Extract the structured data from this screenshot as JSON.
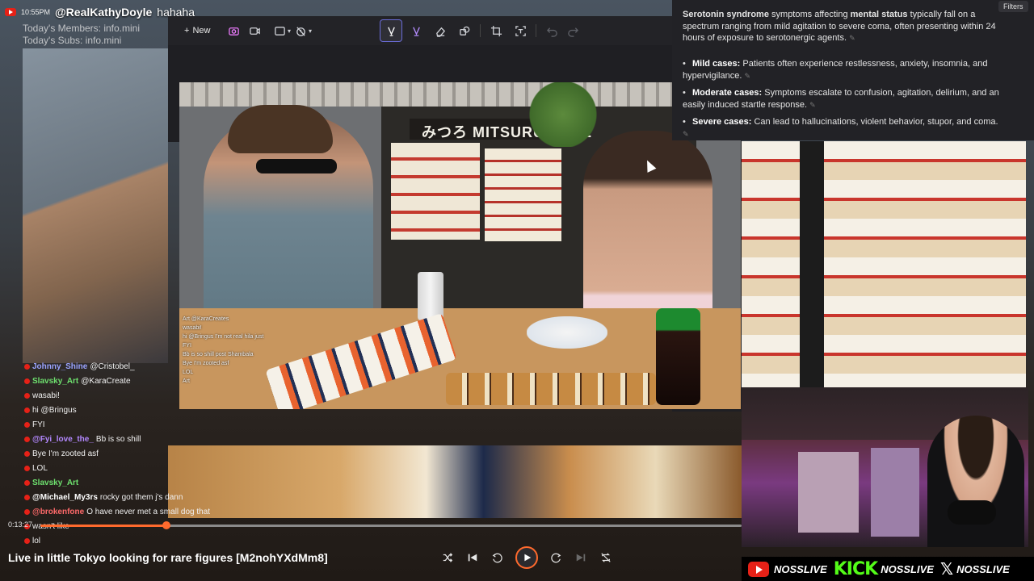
{
  "stream": {
    "time": "10:55PM",
    "handle": "@RealKathyDoyle",
    "caption": "hahaha",
    "overlay_lines": [
      "Today's Members: info.mini",
      "Today's Subs: info.mini"
    ]
  },
  "snip_toolbar": {
    "new_label": "New",
    "icons": [
      "camera-icon",
      "video-icon",
      "rect-mode-icon",
      "delay-icon",
      "highlighter-pen-icon",
      "pen-icon",
      "eraser-icon",
      "shapes-icon",
      "crop-icon",
      "text-extract-icon",
      "undo-icon",
      "redo-icon"
    ]
  },
  "snip_image": {
    "sign_text": "みつろ MITSURU CAFE",
    "chat_lines": [
      "Art @KaraCreates",
      "wasabi!",
      "hi @Bringus I'm not real hila just",
      "FYI",
      "Bb is so shill post Shambala",
      "Bye I'm zooted asf",
      "LOL",
      "Art"
    ]
  },
  "chat": [
    {
      "user": "Johnny_Shine",
      "msg": "@Cristobel_",
      "color": "#9aa3ff"
    },
    {
      "user": "Slavsky_Art",
      "msg": "@KaraCreate",
      "color": "#6ee06e"
    },
    {
      "user": "",
      "msg": "wasabi!",
      "color": "#ff6a6a"
    },
    {
      "user": "",
      "msg": "hi @Bringus",
      "color": "#ffb86c"
    },
    {
      "user": "",
      "msg": "FYI",
      "color": "#ff6a6a"
    },
    {
      "user": "@Fyi_love_the_",
      "msg": "Bb is so shill",
      "color": "#b388ff"
    },
    {
      "user": "",
      "msg": "Bye I'm zooted asf",
      "color": "#ff6a6a"
    },
    {
      "user": "",
      "msg": "LOL",
      "color": "#ff6a6a"
    },
    {
      "user": "Slavsky_Art",
      "msg": "",
      "color": "#6ee06e"
    },
    {
      "user": "@Michael_My3rs",
      "msg": "rocky got them j's dann",
      "color": "#ffffff"
    },
    {
      "user": "@brokenfone",
      "msg": "O have never met a small dog that",
      "color": "#ff6a6a"
    },
    {
      "user": "",
      "msg": "wasn't like",
      "color": "#ff6a6a"
    },
    {
      "user": "",
      "msg": "lol",
      "color": "#ff6a6a"
    }
  ],
  "player": {
    "time": "0:13:27",
    "progress": 0.18,
    "title": "Live in little Tokyo looking for rare figures [M2nohYXdMm8]"
  },
  "ai_panel": {
    "filters_label": "Filters",
    "intro_bold": "Serotonin syndrome",
    "intro_mid": " symptoms affecting ",
    "intro_bold2": "mental status",
    "intro_rest": " typically fall on a spectrum ranging from mild agitation to severe coma, often presenting within 24 hours of exposure to serotonergic agents.",
    "bullets": [
      {
        "label": "Mild cases:",
        "text": "Patients often experience restlessness, anxiety, insomnia, and hypervigilance."
      },
      {
        "label": "Moderate cases:",
        "text": "Symptoms escalate to confusion, agitation, delirium, and an easily induced startle response."
      },
      {
        "label": "Severe cases:",
        "text": "Can lead to hallucinations, violent behavior, stupor, and coma."
      }
    ]
  },
  "social": {
    "youtube": "NOSSLIVE",
    "kick_logo": "KICK",
    "kick": "NOSSLIVE",
    "x": "NOSSLIVE"
  },
  "colors": {
    "accent": "#ff6a2d",
    "toolbar_bg": "#232327",
    "panel_bg": "#222226",
    "kick_green": "#53fc18"
  }
}
